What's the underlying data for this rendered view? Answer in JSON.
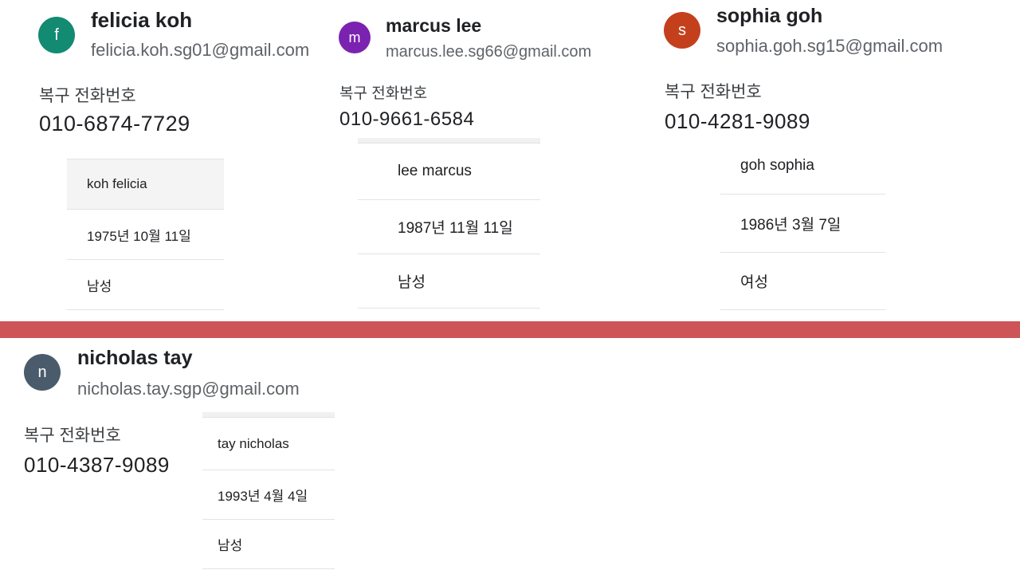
{
  "phone_label": "복구 전화번호",
  "accounts": [
    {
      "initial": "f",
      "avatar_color": "#138a72",
      "name": "felicia koh",
      "email": "felicia.koh.sg01@gmail.com",
      "phone": "010-6874-7729",
      "rows": [
        "koh felicia",
        "1975년 10월 11일",
        "남성"
      ]
    },
    {
      "initial": "m",
      "avatar_color": "#7b22b0",
      "name": "marcus lee",
      "email": "marcus.lee.sg66@gmail.com",
      "phone": "010-9661-6584",
      "rows": [
        "lee marcus",
        "1987년 11월 11일",
        "남성"
      ]
    },
    {
      "initial": "s",
      "avatar_color": "#c4401d",
      "name": "sophia goh",
      "email": "sophia.goh.sg15@gmail.com",
      "phone": "010-4281-9089",
      "rows": [
        "goh sophia",
        "1986년 3월 7일",
        "여성"
      ]
    },
    {
      "initial": "n",
      "avatar_color": "#4a5c6b",
      "name": "nicholas tay",
      "email": "nicholas.tay.sgp@gmail.com",
      "phone": "010-4387-9089",
      "rows": [
        "tay nicholas",
        "1993년 4월 4일",
        "남성"
      ]
    }
  ],
  "divider_color": "#cd5558"
}
